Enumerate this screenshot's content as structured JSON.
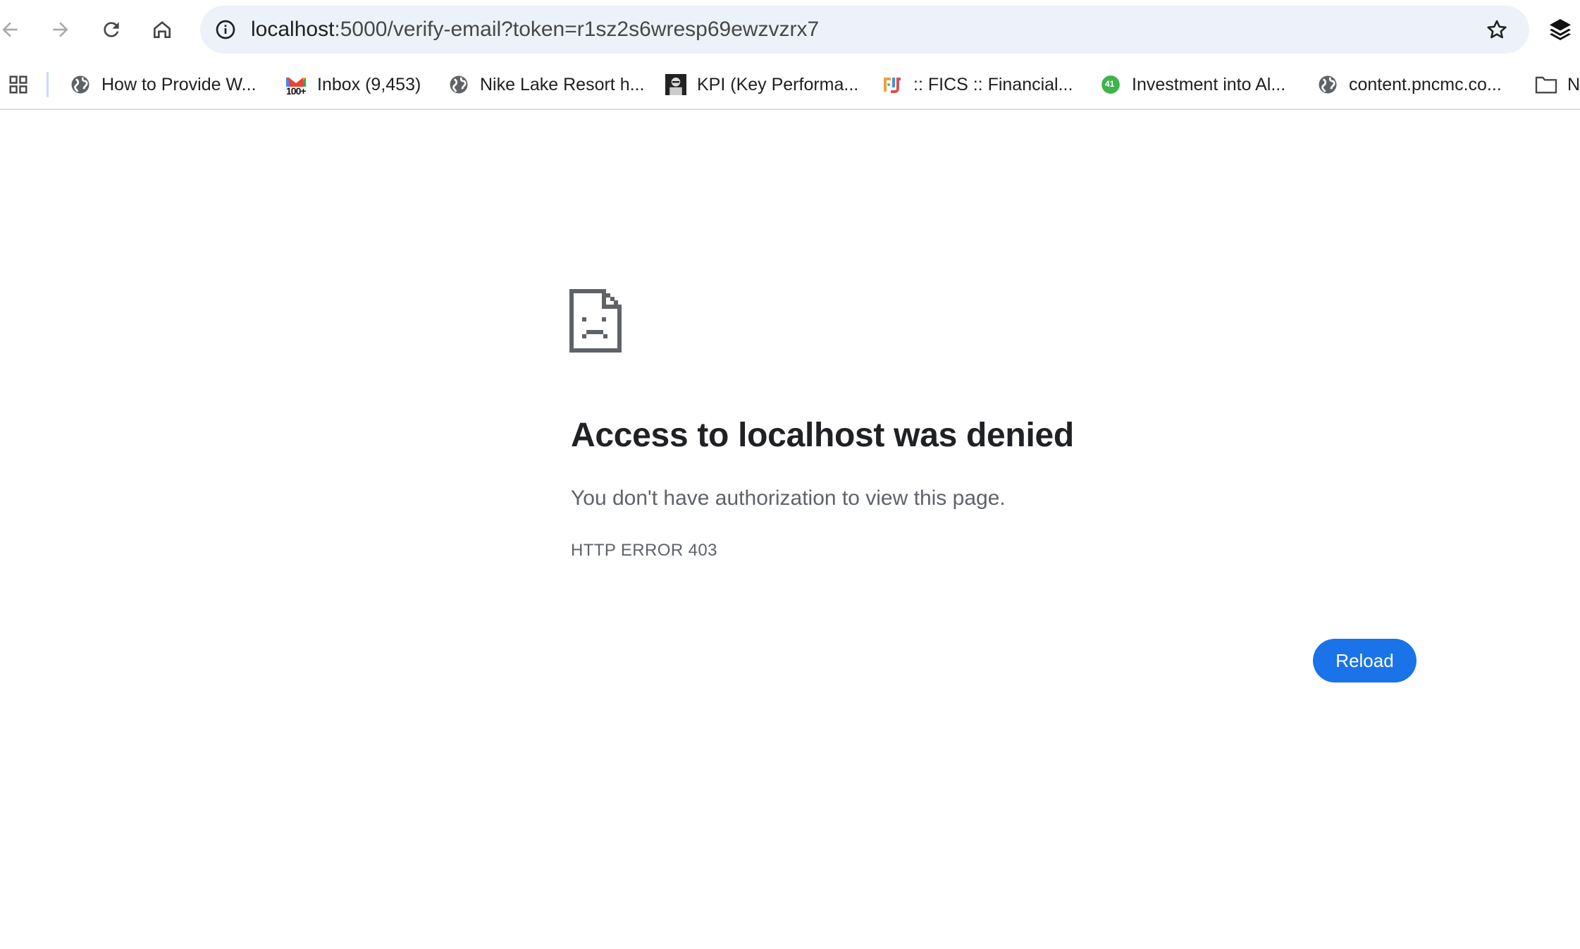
{
  "browser": {
    "url_host": "localhost",
    "url_rest": ":5000/verify-email?token=r1sz2s6wresp69ewzvzrx7",
    "icons": {
      "back": "back-arrow-icon",
      "forward": "forward-arrow-icon",
      "reload": "reload-icon",
      "home": "home-icon",
      "site_info": "info-icon",
      "bookmark_star": "star-icon",
      "extensions": "layers-icon"
    }
  },
  "bookmarks": {
    "items": [
      {
        "label": "How to Provide W...",
        "icon": "globe-icon"
      },
      {
        "label": "Inbox (9,453)",
        "icon": "gmail-icon",
        "badge": "100+"
      },
      {
        "label": "Nike Lake Resort h...",
        "icon": "globe-icon"
      },
      {
        "label": "KPI (Key Performa...",
        "icon": "portrait-icon"
      },
      {
        "label": ":: FICS :: Financial...",
        "icon": "fics-logo-icon"
      },
      {
        "label": "Investment into Al...",
        "icon": "green-badge-icon",
        "badge": "41"
      },
      {
        "label": "content.pncmc.co...",
        "icon": "globe-icon"
      },
      {
        "label": "N",
        "icon": "folder-icon"
      }
    ]
  },
  "error": {
    "icon": "sad-page-icon",
    "title": "Access to localhost was denied",
    "description": "You don't have authorization to view this page.",
    "code": "HTTP ERROR 403",
    "reload_label": "Reload"
  },
  "colors": {
    "omnibox_bg": "#edf2fa",
    "button_blue": "#1a73e8",
    "title_text": "#202124",
    "secondary_text": "#5f6368"
  }
}
